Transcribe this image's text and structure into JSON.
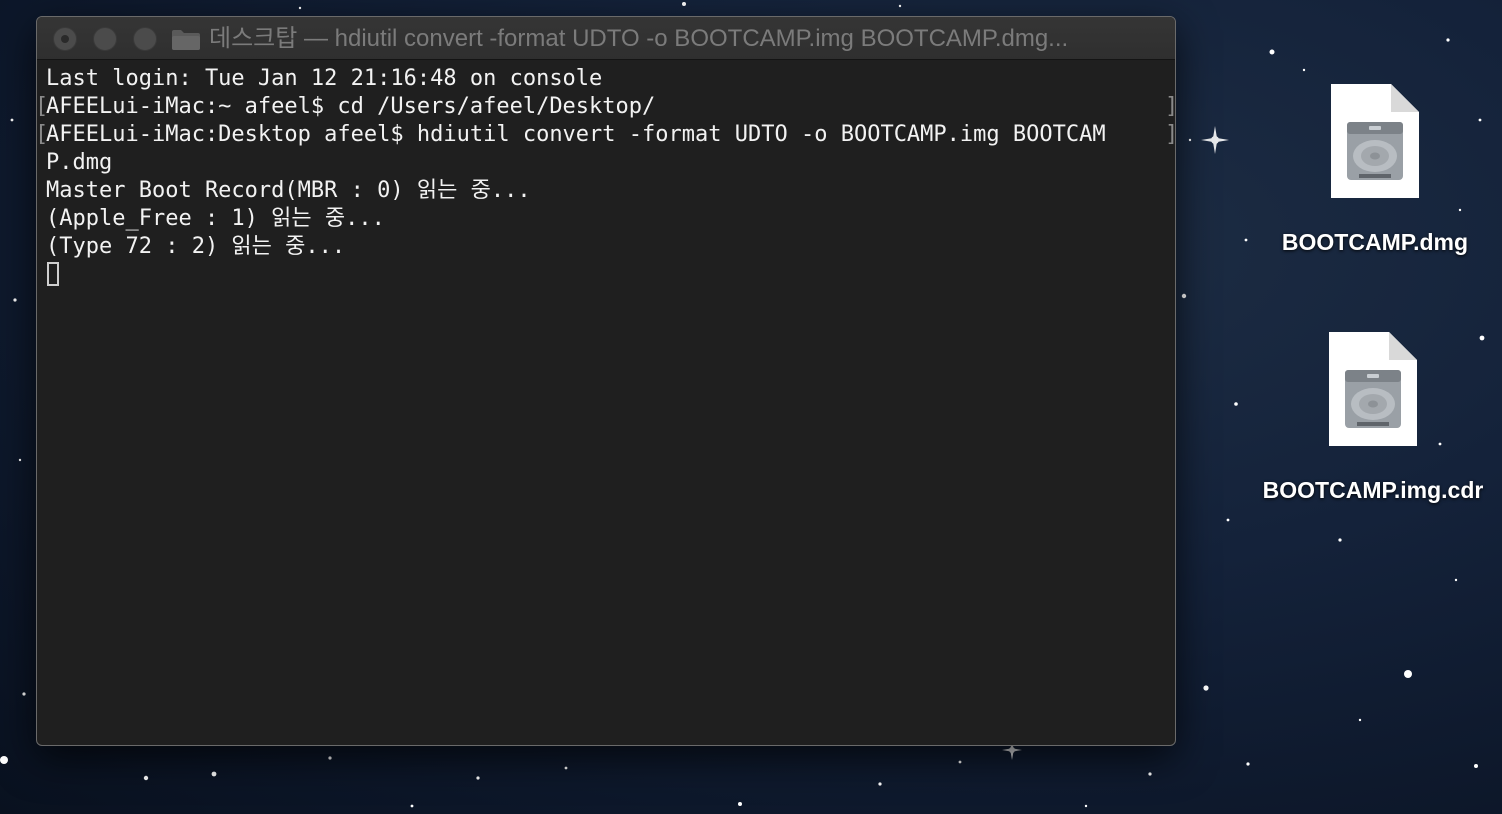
{
  "window": {
    "title": "데스크탑 — hdiutil convert -format UDTO -o BOOTCAMP.img BOOTCAMP.dmg...",
    "folder_icon": "folder-icon"
  },
  "terminal": {
    "lines": [
      "Last login: Tue Jan 12 21:16:48 on console",
      "AFEELui-iMac:~ afeel$ cd /Users/afeel/Desktop/",
      "AFEELui-iMac:Desktop afeel$ hdiutil convert -format UDTO -o BOOTCAMP.img BOOTCAM",
      "P.dmg",
      "Master Boot Record(MBR : 0) 읽는 중...",
      "(Apple_Free : 1) 읽는 중...",
      "(Type 72 : 2) 읽는 중..."
    ],
    "background": "#1f1f1f",
    "text_color": "#f2f2f2"
  },
  "desktop": {
    "files": [
      {
        "name": "BOOTCAMP.dmg",
        "icon": "disk-image-icon"
      },
      {
        "name": "BOOTCAMP.img.cdr",
        "icon": "disk-image-icon"
      }
    ]
  }
}
